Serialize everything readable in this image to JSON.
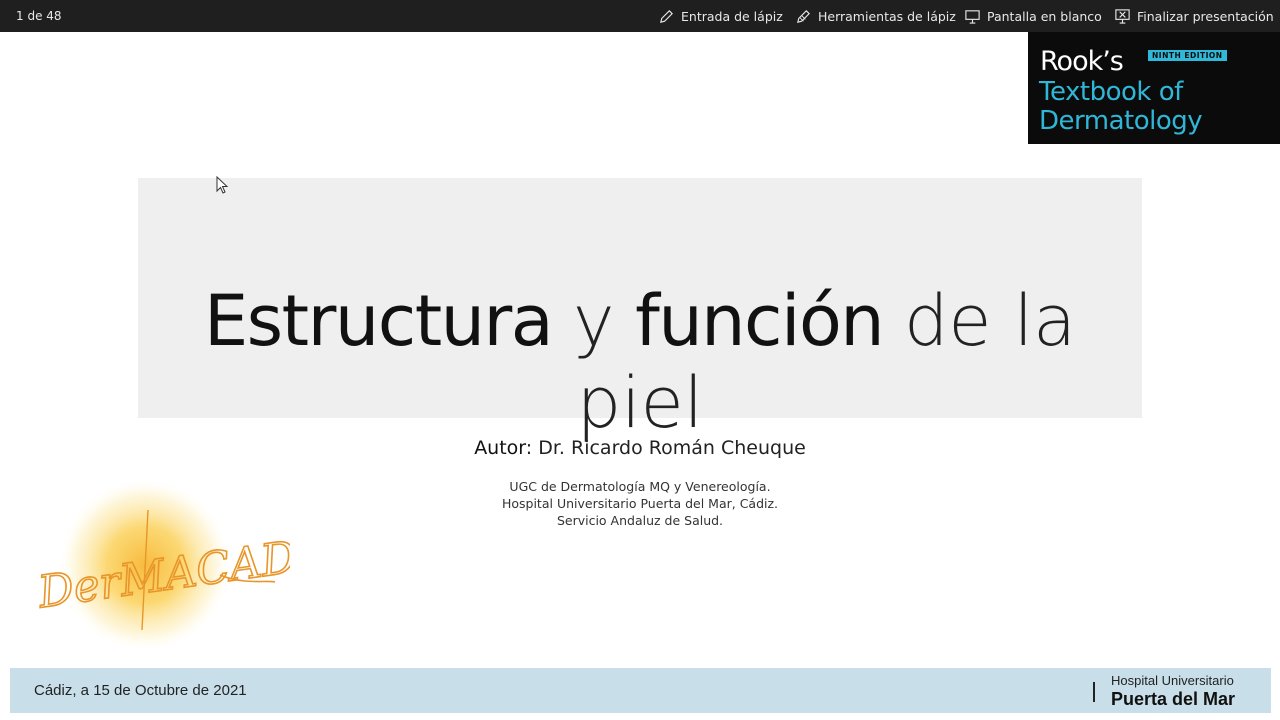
{
  "toolbar": {
    "slide_counter": "1 de 48",
    "buttons": [
      {
        "label": "Entrada de lápiz",
        "icon": "pen-icon"
      },
      {
        "label": "Herramientas de lápiz",
        "icon": "pen-tools-icon"
      },
      {
        "label": "Pantalla en blanco",
        "icon": "blank-screen-icon"
      },
      {
        "label": "Finalizar presentación",
        "icon": "end-presentation-icon"
      }
    ]
  },
  "book_cover": {
    "brand": "Rook’s",
    "edition": "NINTH EDITION",
    "title_line1": "Textbook of",
    "title_line2": "Dermatology"
  },
  "slide": {
    "title_part1": "Estructura",
    "title_part2": "y",
    "title_part3": "función",
    "title_part4": "de la piel",
    "author_label": "Autor",
    "author_name": ": Dr. Ricardo Román Cheuque",
    "affiliation": [
      "UGC de Dermatología MQ y Venereología.",
      "Hospital Universitario Puerta del Mar, Cádiz.",
      "Servicio Andaluz de Salud."
    ],
    "logo_text": "DerMACADiz"
  },
  "footer": {
    "date": "Cádiz, a 15 de Octubre de 2021",
    "hospital_line1": "Hospital Universitario",
    "hospital_line2": "Puerta del Mar"
  },
  "colors": {
    "toolbar_bg": "#1f1f1f",
    "book_accent": "#30b6d6",
    "footer_bg": "#c8dfe9",
    "logo_orange": "#f0a23a"
  }
}
